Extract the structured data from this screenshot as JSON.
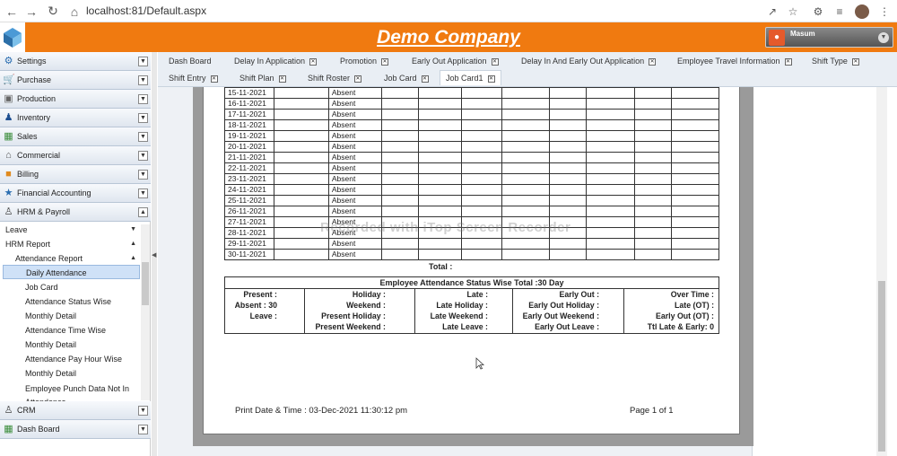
{
  "browser": {
    "url": "localhost:81/Default.aspx",
    "back_icon": "arrow-left-icon",
    "forward_icon": "arrow-right-icon",
    "reload_icon": "reload-icon",
    "home_icon": "home-icon"
  },
  "header": {
    "company": "Demo Company",
    "user": "Masum",
    "color": "#f07a10"
  },
  "sidebar": {
    "modules": [
      {
        "label": "Settings",
        "icon": "gear-icon"
      },
      {
        "label": "Purchase",
        "icon": "cart-icon"
      },
      {
        "label": "Production",
        "icon": "factory-icon"
      },
      {
        "label": "Inventory",
        "icon": "people-icon"
      },
      {
        "label": "Sales",
        "icon": "sales-icon"
      },
      {
        "label": "Commercial",
        "icon": "building-icon"
      },
      {
        "label": "Billing",
        "icon": "billing-icon"
      },
      {
        "label": "Financial Accounting",
        "icon": "finance-icon"
      },
      {
        "label": "HRM & Payroll",
        "icon": "hrm-icon"
      }
    ],
    "hrm_sub": {
      "leave": "Leave",
      "hrm_report": "HRM Report",
      "attendance_report": "Attendance Report",
      "items": [
        "Daily Attendance",
        "Job Card",
        "Attendance Status Wise",
        "Monthly Detail",
        "Attendance Time Wise",
        "Monthly Detail",
        "Attendance Pay Hour Wise",
        "Monthly Detail",
        "Employee Punch Data Not In",
        "Attendance"
      ],
      "selected": "Daily Attendance"
    },
    "bottom_modules": [
      {
        "label": "CRM",
        "icon": "crm-icon"
      },
      {
        "label": "Dash Board",
        "icon": "dashboard-icon"
      }
    ]
  },
  "tabs": {
    "row1": [
      "Dash Board",
      "Delay In Application",
      "Promotion",
      "Early Out Application",
      "Delay In And Early Out Application",
      "Employee Travel Information",
      "Shift Type"
    ],
    "row2": [
      "Shift Entry",
      "Shift Plan",
      "Shift Roster",
      "Job Card",
      "Job Card1"
    ],
    "active": "Job Card1"
  },
  "report": {
    "rows": [
      {
        "date": "15-11-2021",
        "status": "Absent"
      },
      {
        "date": "16-11-2021",
        "status": "Absent"
      },
      {
        "date": "17-11-2021",
        "status": "Absent"
      },
      {
        "date": "18-11-2021",
        "status": "Absent"
      },
      {
        "date": "19-11-2021",
        "status": "Absent"
      },
      {
        "date": "20-11-2021",
        "status": "Absent"
      },
      {
        "date": "21-11-2021",
        "status": "Absent"
      },
      {
        "date": "22-11-2021",
        "status": "Absent"
      },
      {
        "date": "23-11-2021",
        "status": "Absent"
      },
      {
        "date": "24-11-2021",
        "status": "Absent"
      },
      {
        "date": "25-11-2021",
        "status": "Absent"
      },
      {
        "date": "26-11-2021",
        "status": "Absent"
      },
      {
        "date": "27-11-2021",
        "status": "Absent"
      },
      {
        "date": "28-11-2021",
        "status": "Absent"
      },
      {
        "date": "29-11-2021",
        "status": "Absent"
      },
      {
        "date": "30-11-2021",
        "status": "Absent"
      }
    ],
    "total_label": "Total :",
    "status_title": "Employee Attendance Status Wise Total  :30 Day",
    "col1": [
      "Present :",
      "Absent : 30",
      "Leave :"
    ],
    "col2": [
      "Holiday :",
      "Weekend :",
      "Present Holiday :",
      "Present Weekend :"
    ],
    "col3": [
      "Late :",
      "Late Holiday :",
      "Late Weekend :",
      "Late Leave :"
    ],
    "col4": [
      "Early Out :",
      "Early Out Holiday :",
      "Early Out Weekend :",
      "Early Out Leave :"
    ],
    "col5": [
      "Over Time :",
      "Late (OT) :",
      "Early Out (OT) :",
      "Ttl Late & Early: 0"
    ],
    "print_label": "Print Date & Time :",
    "print_value": "03-Dec-2021 11:30:12 pm",
    "page_info": "Page 1 of 1",
    "watermark": "Recorded with iTop Screen Recorder"
  }
}
